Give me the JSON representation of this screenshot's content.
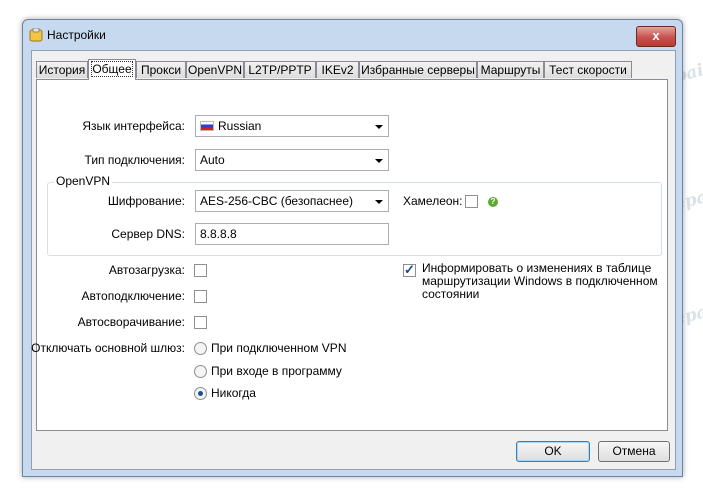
{
  "window": {
    "title": "Настройки",
    "close_label": "x"
  },
  "tabs": [
    "История",
    "Общее",
    "Прокси",
    "OpenVPN",
    "L2TP/PPTP",
    "IKEv2",
    "Избранные серверы",
    "Маршруты",
    "Тест скорости"
  ],
  "active_tab": "Общее",
  "general": {
    "language_label": "Язык интерфейса:",
    "language_value": "Russian",
    "connection_type_label": "Тип подключения:",
    "connection_type_value": "Auto",
    "openvpn_group_title": "OpenVPN",
    "encryption_label": "Шифрование:",
    "encryption_value": "AES-256-CBC (безопаснее)",
    "chameleon_label": "Хамелеон:",
    "chameleon_checked": false,
    "dns_label": "Сервер DNS:",
    "dns_value": "8.8.8.8",
    "autostart_label": "Автозагрузка:",
    "autoconnect_label": "Автоподключение:",
    "autominimize_label": "Автосворачивание:",
    "notify_routes_label_line1": "Информировать о изменениях в таблице",
    "notify_routes_label_line2": "маршрутизации Windows в подключенном",
    "notify_routes_label_line3": "состоянии",
    "notify_routes_checked": true,
    "gateway_label": "Отключать основной шлюз:",
    "gateway_options": [
      "При подключенном VPN",
      "При входе в программу",
      "Никогда"
    ],
    "gateway_selected": "Никогда"
  },
  "buttons": {
    "ok": "OK",
    "cancel": "Отмена"
  },
  "watermark": "Soringpcrepair.Com"
}
